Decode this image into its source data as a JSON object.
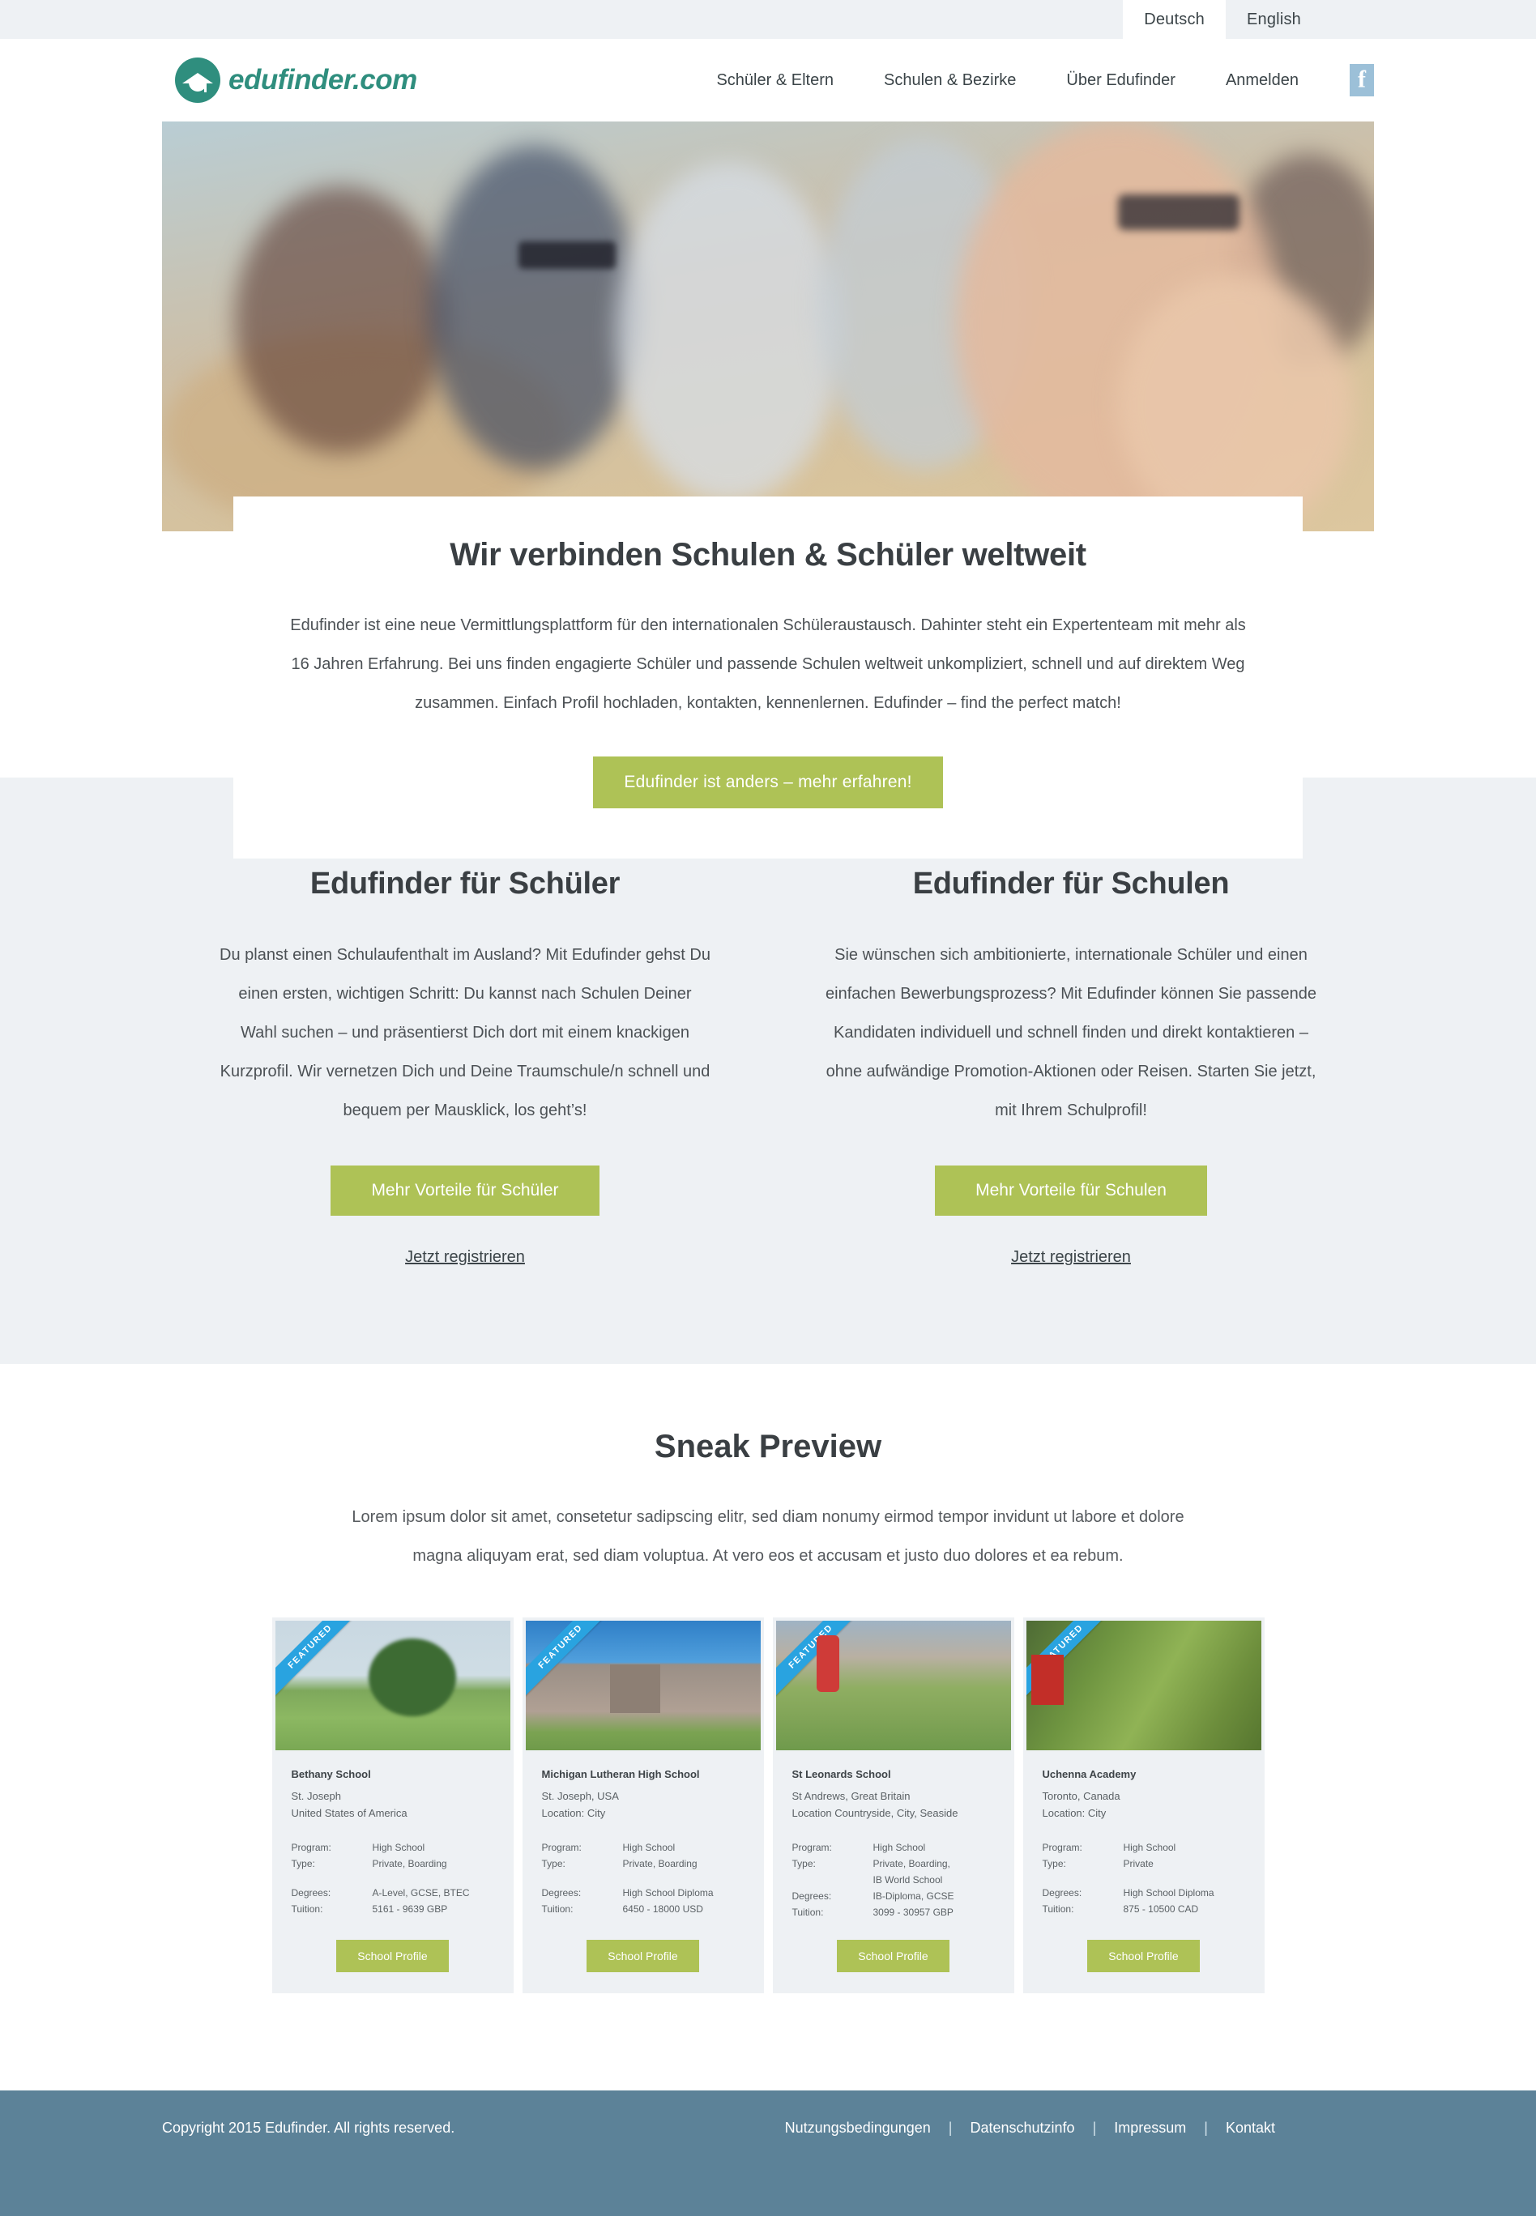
{
  "language_bar": {
    "tabs": [
      {
        "label": "Deutsch",
        "active": true
      },
      {
        "label": "English",
        "active": false
      }
    ]
  },
  "header": {
    "logo_text": "edufinder.com",
    "logo_icon": "graduation-cap-icon",
    "nav": [
      {
        "label": "Schüler & Eltern"
      },
      {
        "label": "Schulen & Bezirke"
      },
      {
        "label": "Über Edufinder"
      },
      {
        "label": "Anmelden"
      }
    ],
    "social_icon": "facebook-icon"
  },
  "hero": {
    "image_alt": "group of smiling young people outdoors",
    "title": "Wir verbinden Schulen & Schüler weltweit",
    "paragraph": "Edufinder ist eine neue Vermittlungsplattform für den internationalen Schüleraustausch. Dahinter steht ein Expertenteam mit mehr als 16 Jahren Erfahrung.  Bei uns finden engagierte Schüler und passende Schulen weltweit unkompliziert, schnell und auf direktem Weg zusammen. Einfach Profil hochladen, kontakten, kennenlernen. Edufinder – find the perfect match!",
    "cta_label": "Edufinder ist anders – mehr erfahren!"
  },
  "columns": [
    {
      "title": "Edufinder für Schüler",
      "paragraph": "Du planst einen Schulaufenthalt im Ausland? Mit Edufinder gehst Du einen ersten, wichtigen Schritt: Du kannst nach Schulen Deiner Wahl suchen – und präsentierst Dich dort mit einem knackigen Kurzprofil. Wir vernetzen Dich und Deine Traumschule/n schnell und bequem per Mausklick, los geht’s!",
      "button_label": "Mehr Vorteile für Schüler",
      "link_label": "Jetzt registrieren"
    },
    {
      "title": "Edufinder für Schulen",
      "paragraph": "Sie wünschen sich ambitionierte, internationale Schüler und einen einfachen Bewerbungsprozess? Mit Edufinder können Sie passende Kandidaten individuell und schnell finden und direkt kontaktieren – ohne aufwändige Promotion-Aktionen oder Reisen. Starten Sie jetzt, mit Ihrem Schulprofil!",
      "button_label": "Mehr Vorteile für Schulen",
      "link_label": "Jetzt registrieren"
    }
  ],
  "preview": {
    "title": "Sneak Preview",
    "subtitle": "Lorem ipsum dolor sit amet, consetetur sadipscing elitr, sed diam nonumy eirmod tempor invidunt ut labore et dolore magna aliquyam erat, sed diam voluptua. At vero eos et accusam et justo duo dolores et ea rebum.",
    "ribbon_label": "FEATURED",
    "cta_label": "School Profile",
    "labels": {
      "program": "Program:",
      "type": "Type:",
      "degrees": "Degrees:",
      "tuition": "Tuition:"
    },
    "cards": [
      {
        "name": "Bethany School",
        "city": "St. Joseph",
        "country": "United States of America",
        "program": "High School",
        "type": "Private, Boarding",
        "type_line2": "",
        "degrees": "A-Level, GCSE, BTEC",
        "tuition": "5161 - 9639 GBP",
        "image_alt": "school playing field with large tree"
      },
      {
        "name": "Michigan Lutheran High School",
        "city": "St. Joseph, USA",
        "country": "Location: City",
        "program": "High School",
        "type": "Private, Boarding",
        "type_line2": "",
        "degrees": "High School Diploma",
        "tuition": "6450 - 18000 USD",
        "image_alt": "brick school building entrance"
      },
      {
        "name": "St Leonards School",
        "city": "St Andrews, Great Britain",
        "country": "Location Countryside, City, Seaside",
        "program": "High School",
        "type": "Private, Boarding,",
        "type_line2": "IB World School",
        "degrees": "IB-Diploma, GCSE",
        "tuition": "3099 - 30957 GBP",
        "image_alt": "golfers on course in front of historic building"
      },
      {
        "name": "Uchenna Academy",
        "city": "Toronto, Canada",
        "country": "Location: City",
        "program": "High School",
        "type": "Private",
        "type_line2": "",
        "degrees": "High School Diploma",
        "tuition": "875 - 10500 CAD",
        "image_alt": "green tree foliage on a city street"
      }
    ]
  },
  "footer": {
    "copyright": "Copyright 2015 Edufinder. All rights reserved.",
    "separator": "|",
    "links": [
      {
        "label": "Nutzungsbedingungen"
      },
      {
        "label": "Datenschutzinfo"
      },
      {
        "label": "Impressum"
      },
      {
        "label": "Kontakt"
      }
    ]
  },
  "colors": {
    "brand_teal": "#2f8e7e",
    "accent_green": "#aec256",
    "ribbon_blue": "#29a3e0",
    "footer_blue": "#5c8298",
    "section_gray": "#eef1f4",
    "facebook_blue": "#9cc0d8"
  }
}
